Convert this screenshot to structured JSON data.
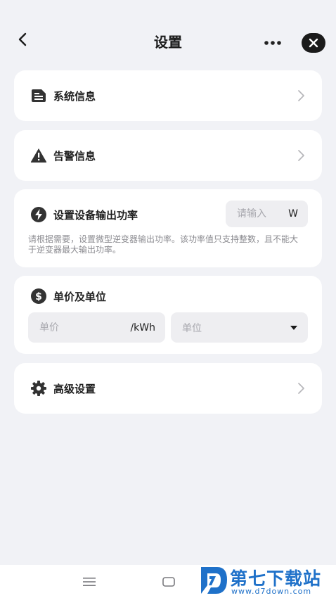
{
  "header": {
    "title": "设置"
  },
  "cards": {
    "system_info": {
      "label": "系统信息"
    },
    "alarm_info": {
      "label": "告警信息"
    },
    "power": {
      "label": "设置设备输出功率",
      "input_placeholder": "请输入",
      "unit": "W",
      "description": "请根据需要，设置微型逆变器输出功率。该功率值只支持整数，且不能大于逆变器最大输出功率。"
    },
    "price": {
      "label": "单价及单位",
      "price_placeholder": "单价",
      "price_unit": "/kWh",
      "unit_placeholder": "单位"
    },
    "advanced": {
      "label": "高级设置"
    }
  },
  "watermark": {
    "title": "第七下载站",
    "url": "www.d7down.com"
  },
  "colors": {
    "background": "#f1f2f6",
    "card": "#ffffff",
    "input_bg": "#eeeef1",
    "watermark": "#1f71c9"
  },
  "icons": {
    "back": "chevron-left-icon",
    "more": "more-dots-icon",
    "close": "close-icon",
    "system_info": "document-icon",
    "alarm_info": "warning-icon",
    "power": "lightning-icon",
    "price": "dollar-icon",
    "advanced": "gear-icon",
    "nav_menu": "menu-icon",
    "nav_home": "home-icon"
  }
}
